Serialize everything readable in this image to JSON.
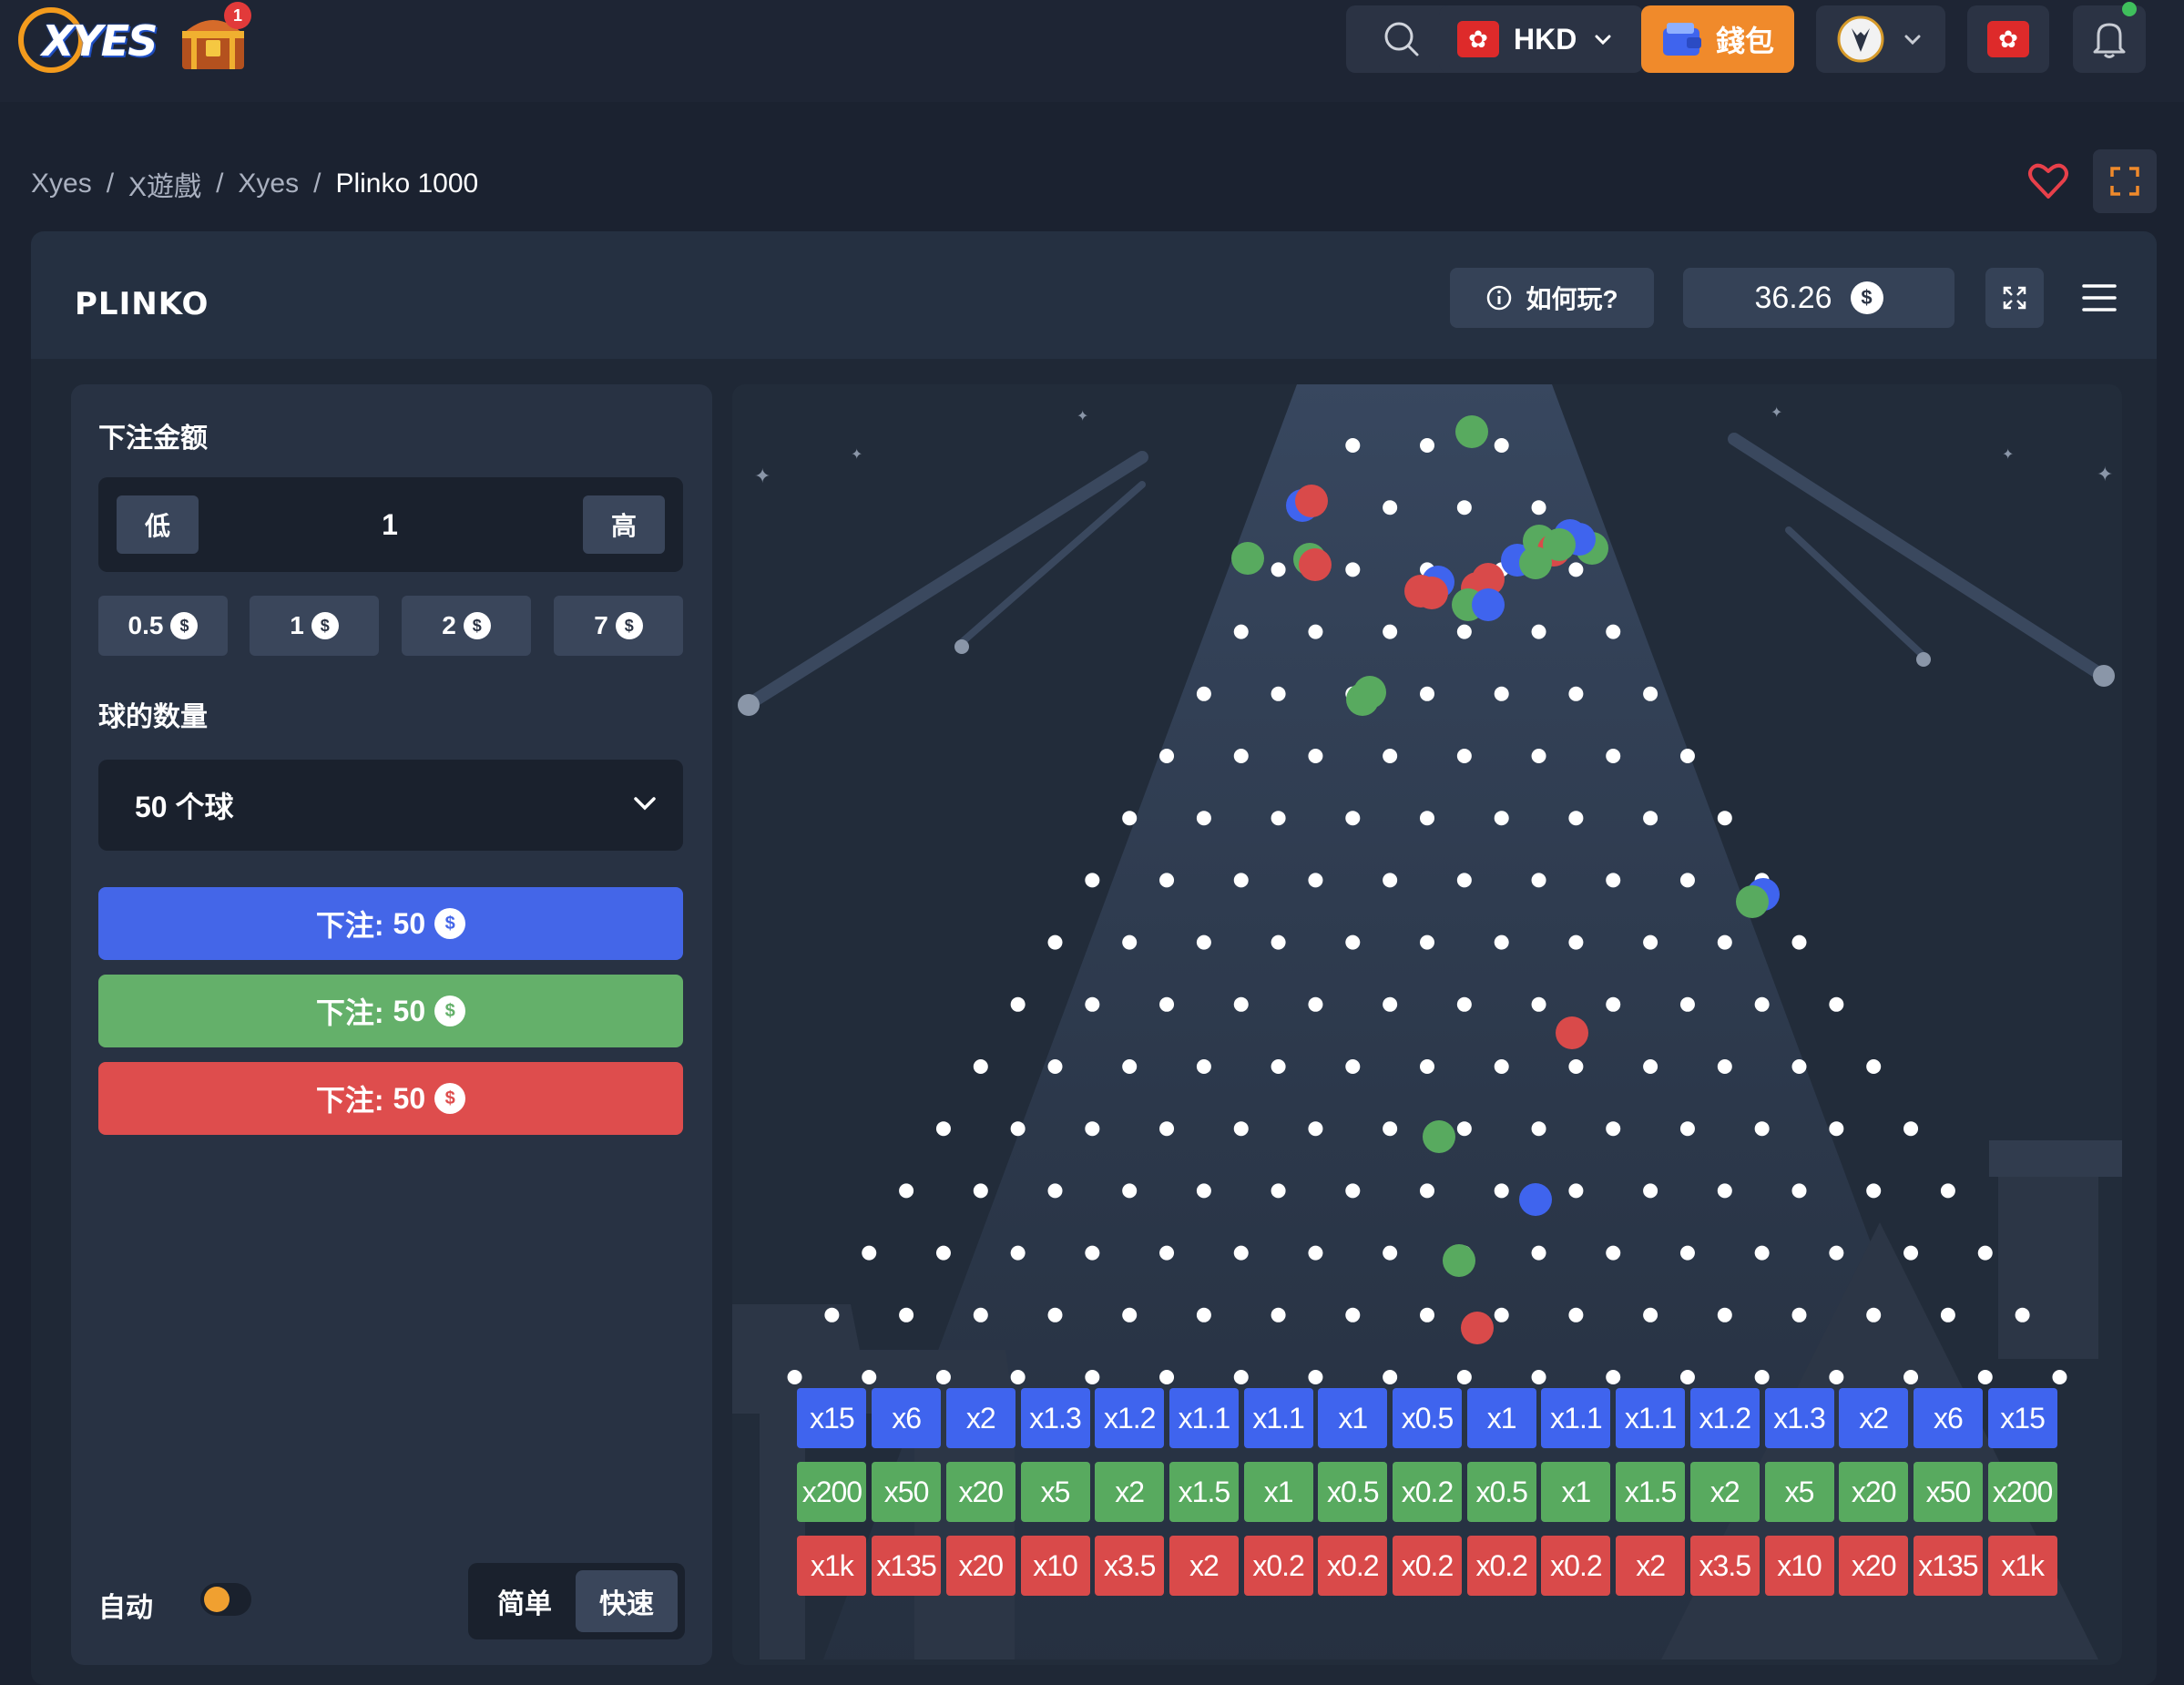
{
  "header": {
    "logo_text": "XYES",
    "chest_badge": "1",
    "currency": "HKD",
    "wallet_label": "錢包",
    "icons": [
      "search-icon",
      "hk-flag-icon",
      "chevron-down-icon",
      "wallet-icon",
      "avatar-icon",
      "bell-icon"
    ]
  },
  "breadcrumb": {
    "items": [
      "Xyes",
      "X遊戲",
      "Xyes"
    ],
    "current": "Plinko 1000",
    "separator": "/"
  },
  "game": {
    "logo": "PLINKO",
    "how_to_play": "如何玩?",
    "balance": "36.26",
    "currency_symbol": "$"
  },
  "panel": {
    "bet_amount_label": "下注金额",
    "low_label": "低",
    "high_label": "高",
    "bet_value": "1",
    "chips": [
      "0.5",
      "1",
      "2",
      "7"
    ],
    "ball_count_label": "球的数量",
    "ball_count_value": "50 个球",
    "bet_buttons": [
      {
        "label": "下注:",
        "amount": "50",
        "color": "#4466e8"
      },
      {
        "label": "下注:",
        "amount": "50",
        "color": "#64b06a"
      },
      {
        "label": "下注:",
        "amount": "50",
        "color": "#de4d4d"
      }
    ],
    "auto_label": "自动",
    "mode_simple": "简单",
    "mode_fast": "快速"
  },
  "board": {
    "multipliers_blue": [
      "x15",
      "x6",
      "x2",
      "x1.3",
      "x1.2",
      "x1.1",
      "x1.1",
      "x1",
      "x0.5",
      "x1",
      "x1.1",
      "x1.1",
      "x1.2",
      "x1.3",
      "x2",
      "x6",
      "x15"
    ],
    "multipliers_green": [
      "x200",
      "x50",
      "x20",
      "x5",
      "x2",
      "x1.5",
      "x1",
      "x0.5",
      "x0.2",
      "x0.5",
      "x1",
      "x1.5",
      "x2",
      "x5",
      "x20",
      "x50",
      "x200"
    ],
    "multipliers_red": [
      "x1k",
      "x135",
      "x20",
      "x10",
      "x3.5",
      "x2",
      "x0.2",
      "x0.2",
      "x0.2",
      "x0.2",
      "x0.2",
      "x2",
      "x3.5",
      "x10",
      "x20",
      "x135",
      "x1k"
    ],
    "colors": {
      "blue": "#3f64ee",
      "green": "#58aa5f",
      "red": "#d94a4a"
    }
  }
}
